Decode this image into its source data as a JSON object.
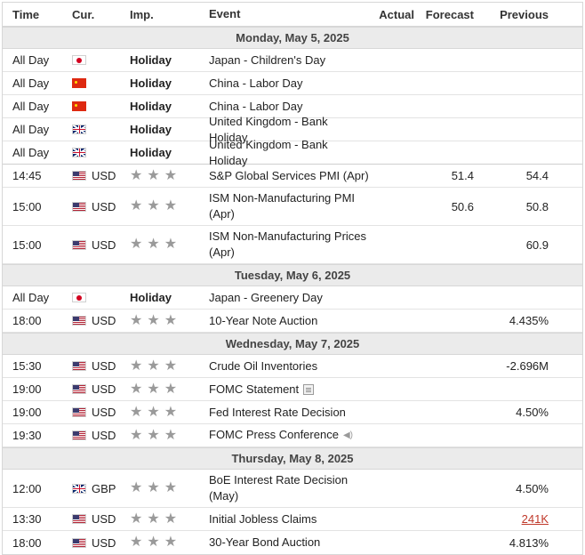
{
  "header": {
    "time": "Time",
    "currency": "Cur.",
    "importance": "Imp.",
    "event": "Event",
    "actual": "Actual",
    "forecast": "Forecast",
    "previous": "Previous"
  },
  "days": [
    {
      "date": "Monday, May 5, 2025",
      "events": [
        {
          "time": "All Day",
          "flag": "japan-flag-icon",
          "currency": "",
          "importance": "Holiday",
          "event": "Japan - Children's Day",
          "actual": "",
          "forecast": "",
          "previous": ""
        },
        {
          "time": "All Day",
          "flag": "china-flag-icon",
          "currency": "",
          "importance": "Holiday",
          "event": "China - Labor Day",
          "actual": "",
          "forecast": "",
          "previous": ""
        },
        {
          "time": "All Day",
          "flag": "china-flag-icon",
          "currency": "",
          "importance": "Holiday",
          "event": "China - Labor Day",
          "actual": "",
          "forecast": "",
          "previous": ""
        },
        {
          "time": "All Day",
          "flag": "uk-flag-icon",
          "currency": "",
          "importance": "Holiday",
          "event": "United Kingdom - Bank Holiday",
          "actual": "",
          "forecast": "",
          "previous": ""
        },
        {
          "time": "All Day",
          "flag": "uk-flag-icon",
          "currency": "",
          "importance": "Holiday",
          "event": "United Kingdom - Bank Holiday",
          "actual": "",
          "forecast": "",
          "previous": ""
        },
        {
          "time": "14:45",
          "flag": "us-flag-icon",
          "currency": "USD",
          "stars": 3,
          "event": "S&P Global Services PMI (Apr)",
          "actual": "",
          "forecast": "51.4",
          "previous": "54.4"
        },
        {
          "time": "15:00",
          "flag": "us-flag-icon",
          "currency": "USD",
          "stars": 3,
          "event": "ISM Non-Manufacturing PMI (Apr)",
          "actual": "",
          "forecast": "50.6",
          "previous": "50.8"
        },
        {
          "time": "15:00",
          "flag": "us-flag-icon",
          "currency": "USD",
          "stars": 3,
          "event": "ISM Non-Manufacturing Prices (Apr)",
          "actual": "",
          "forecast": "",
          "previous": "60.9"
        }
      ]
    },
    {
      "date": "Tuesday, May 6, 2025",
      "events": [
        {
          "time": "All Day",
          "flag": "japan-flag-icon",
          "currency": "",
          "importance": "Holiday",
          "event": "Japan - Greenery Day",
          "actual": "",
          "forecast": "",
          "previous": ""
        },
        {
          "time": "18:00",
          "flag": "us-flag-icon",
          "currency": "USD",
          "stars": 3,
          "event": "10-Year Note Auction",
          "actual": "",
          "forecast": "",
          "previous": "4.435%"
        }
      ]
    },
    {
      "date": "Wednesday, May 7, 2025",
      "events": [
        {
          "time": "15:30",
          "flag": "us-flag-icon",
          "currency": "USD",
          "stars": 3,
          "event": "Crude Oil Inventories",
          "actual": "",
          "forecast": "",
          "previous": "-2.696M"
        },
        {
          "time": "19:00",
          "flag": "us-flag-icon",
          "currency": "USD",
          "stars": 3,
          "event": "FOMC Statement",
          "icon": "document-icon",
          "actual": "",
          "forecast": "",
          "previous": ""
        },
        {
          "time": "19:00",
          "flag": "us-flag-icon",
          "currency": "USD",
          "stars": 3,
          "event": "Fed Interest Rate Decision",
          "actual": "",
          "forecast": "",
          "previous": "4.50%"
        },
        {
          "time": "19:30",
          "flag": "us-flag-icon",
          "currency": "USD",
          "stars": 3,
          "event": "FOMC Press Conference",
          "icon": "speaker-icon",
          "actual": "",
          "forecast": "",
          "previous": ""
        }
      ]
    },
    {
      "date": "Thursday, May 8, 2025",
      "events": [
        {
          "time": "12:00",
          "flag": "uk-flag-icon",
          "currency": "GBP",
          "stars": 3,
          "event": "BoE Interest Rate Decision (May)",
          "actual": "",
          "forecast": "",
          "previous": "4.50%"
        },
        {
          "time": "13:30",
          "flag": "us-flag-icon",
          "currency": "USD",
          "stars": 3,
          "event": "Initial Jobless Claims",
          "actual": "",
          "forecast": "",
          "previous": "241K",
          "previous_color": "#c0392b"
        },
        {
          "time": "18:00",
          "flag": "us-flag-icon",
          "currency": "USD",
          "stars": 3,
          "event": "30-Year Bond Auction",
          "actual": "",
          "forecast": "",
          "previous": "4.813%"
        }
      ]
    }
  ]
}
